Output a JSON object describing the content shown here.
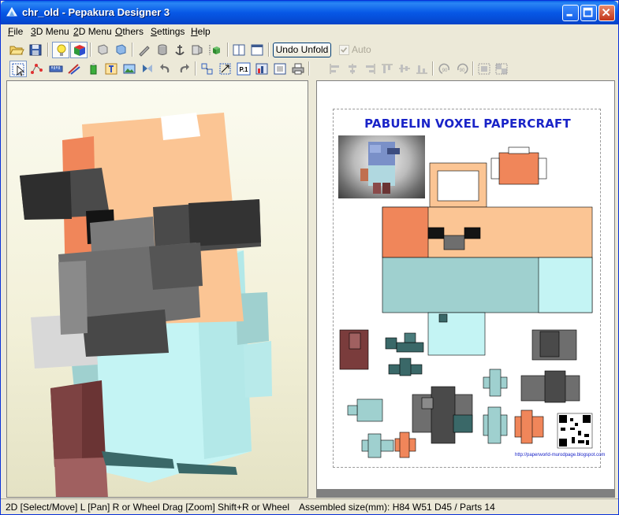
{
  "window": {
    "title": "chr_old - Pepakura Designer 3",
    "icon": "pepakura-app-icon",
    "buttons": [
      "minimize-icon",
      "maximize-icon",
      "close-icon"
    ]
  },
  "menubar": {
    "items": [
      {
        "label": "File",
        "hotkey": "F"
      },
      {
        "label": "3D Menu",
        "hotkey": "3"
      },
      {
        "label": "2D Menu",
        "hotkey": "2"
      },
      {
        "label": "Others",
        "hotkey": "O"
      },
      {
        "label": "Settings",
        "hotkey": "S"
      },
      {
        "label": "Help",
        "hotkey": "H"
      }
    ]
  },
  "toolbar1": {
    "undo_unfold": "Undo Unfold",
    "auto_label": "Auto",
    "auto_checked": true,
    "auto_enabled": false
  },
  "pane2d": {
    "sheet_title": "PABUELIN VOXEL PAPERCRAFT",
    "url": "http://paperworld-murodpage.blogspot.com"
  },
  "statusbar": {
    "hint": "2D [Select/Move] L [Pan] R or Wheel Drag [Zoom] Shift+R or Wheel",
    "info": "Assembled size(mm): H84 W51 D45 / Parts 14"
  },
  "colors": {
    "titlebar": "#0758e6",
    "skin": "#fbc594",
    "skin_dark": "#f0865a",
    "hair_dark": "#4a4a4a",
    "beard": "#6e6e6e",
    "shirt": "#c4f4f4",
    "shirt_shade": "#9fd0cf",
    "pants": "#7a3c3c",
    "title_blue": "#1a24c8"
  }
}
